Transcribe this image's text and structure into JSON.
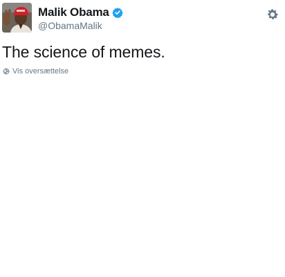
{
  "user": {
    "display_name": "Malik Obama",
    "handle": "@ObamaMalik",
    "verified": true,
    "avatar_icon": "profile-photo-red-cap"
  },
  "tweet": {
    "text": "The science of memes."
  },
  "translate": {
    "label": "Vis oversættelse",
    "icon": "globe-icon"
  },
  "actions": {
    "settings_icon": "gear-icon"
  },
  "colors": {
    "verified": "#1da1f2",
    "muted": "#657786",
    "text": "#14171a",
    "cap": "#d0202a"
  }
}
